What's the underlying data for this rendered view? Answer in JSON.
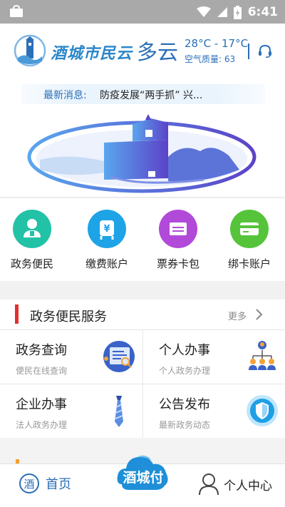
{
  "status_bar": {
    "time": "6:41",
    "icons": [
      "app-notification-icon",
      "wifi-icon",
      "signal-icon",
      "battery-charging-icon"
    ]
  },
  "header": {
    "app_name": "酒城市民云",
    "weather": "多云",
    "temperature": "28°C - 17°C",
    "air_quality": "空气质量: 63",
    "support_icon": "headset-icon"
  },
  "news": {
    "label": "最新消息:",
    "text": "防疫发展“两手抓” 兴..."
  },
  "quick_actions": [
    {
      "label": "政务便民",
      "icon": "person-service-icon",
      "color": "#22c2a6"
    },
    {
      "label": "缴费账户",
      "icon": "yen-payment-icon",
      "color": "#1ea3e6"
    },
    {
      "label": "票券卡包",
      "icon": "ticket-icon",
      "color": "#b14ad8"
    },
    {
      "label": "绑卡账户",
      "icon": "bank-card-icon",
      "color": "#55c43a"
    }
  ],
  "services_section": {
    "title": "政务便民服务",
    "more": "更多"
  },
  "services": [
    {
      "title": "政务查询",
      "subtitle": "便民在线查询",
      "icon": "search-document-icon"
    },
    {
      "title": "个人办事",
      "subtitle": "个人政务办理",
      "icon": "people-network-icon"
    },
    {
      "title": "企业办事",
      "subtitle": "法人政务办理",
      "icon": "necktie-icon"
    },
    {
      "title": "公告发布",
      "subtitle": "最新政务动态",
      "icon": "shield-check-icon"
    }
  ],
  "bottom_nav": {
    "home": "首页",
    "pay": "酒城付",
    "me": "个人中心"
  },
  "colors": {
    "brand_blue": "#2a6fb8",
    "accent_red": "#e0312f",
    "status_bar": "#a9a9a9"
  }
}
